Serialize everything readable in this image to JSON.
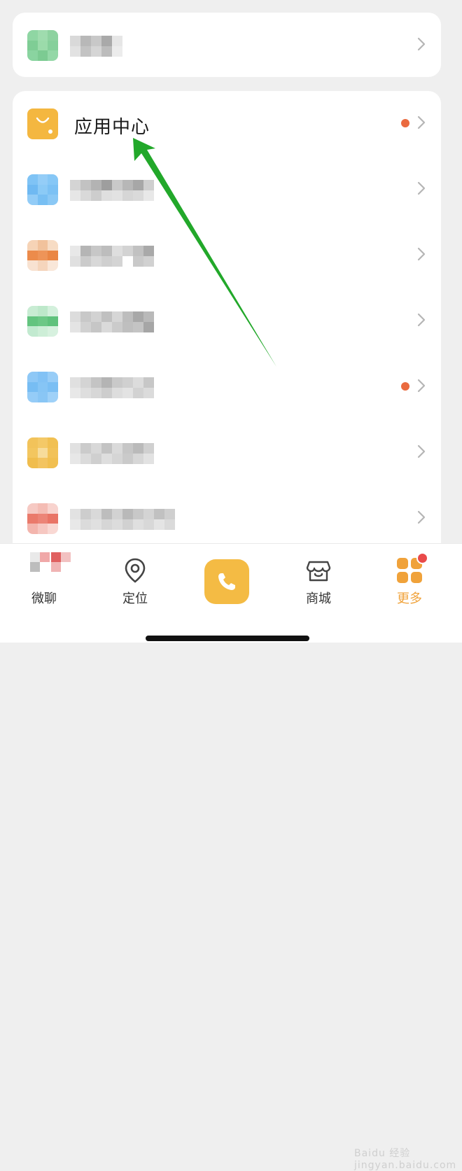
{
  "menu": {
    "top_item": {
      "icon": "blurred-green-icon",
      "has_dot": false
    },
    "items": [
      {
        "label": "应用中心",
        "icon": "shopping-bag-icon",
        "icon_color": "#f4b740",
        "has_dot": true
      },
      {
        "label": "",
        "icon": "blurred-blue-icon",
        "has_dot": false
      },
      {
        "label": "",
        "icon": "blurred-orange-icon",
        "has_dot": false
      },
      {
        "label": "",
        "icon": "blurred-green-icon",
        "has_dot": false
      },
      {
        "label": "",
        "icon": "blurred-blue-icon",
        "has_dot": true
      },
      {
        "label": "",
        "icon": "blurred-yellow-icon",
        "has_dot": false
      },
      {
        "label": "",
        "icon": "blurred-red-icon",
        "has_dot": false
      }
    ],
    "dot_color": "#ea6a3f"
  },
  "tabbar": {
    "tabs": [
      {
        "label": "微聊",
        "icon": "chat-icon",
        "active": false
      },
      {
        "label": "定位",
        "icon": "location-pin-icon",
        "active": false
      },
      {
        "label": "",
        "icon": "phone-icon",
        "active": false
      },
      {
        "label": "商城",
        "icon": "store-icon",
        "active": false
      },
      {
        "label": "更多",
        "icon": "more-grid-icon",
        "active": true
      }
    ],
    "accent_color": "#f4bb44"
  },
  "watermark": "Baidu 经验  jingyan.baidu.com"
}
